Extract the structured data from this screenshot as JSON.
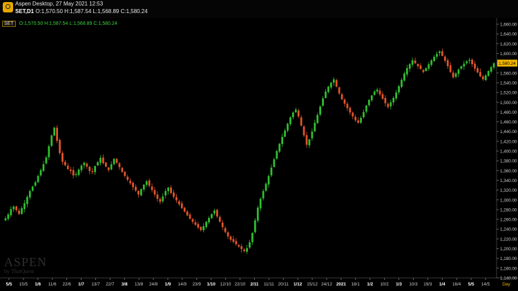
{
  "window": {
    "title": "Aspen Desktop, 27 May 2021 12:53",
    "symbol": "SET,D1",
    "ohlc": "O:1,570.50 H:1,587.54 L:1,568.89 C:1,580.24"
  },
  "legend": {
    "symbol": "SET",
    "values": "O:1,570.50 H:1,587.54 L:1,568.89 C:1,580.24"
  },
  "watermark": {
    "main": "ASPEN",
    "sub": "by ThaiQuest"
  },
  "colors": {
    "up": "#2fc02f",
    "down": "#e2552b",
    "price_badge": "#f2b600",
    "axis_text": "#cfcfcf"
  },
  "chart_data": {
    "type": "candlestick",
    "ylim": [
      1140,
      1670
    ],
    "y_ticks": [
      "1,140.00",
      "1,160.00",
      "1,180.00",
      "1,200.00",
      "1,220.00",
      "1,240.00",
      "1,260.00",
      "1,280.00",
      "1,300.00",
      "1,320.00",
      "1,340.00",
      "1,360.00",
      "1,380.00",
      "1,400.00",
      "1,420.00",
      "1,440.00",
      "1,460.00",
      "1,480.00",
      "1,500.00",
      "1,520.00",
      "1,540.00",
      "1,560.00",
      "1,580.00",
      "1,600.00",
      "1,620.00",
      "1,640.00",
      "1,660.00"
    ],
    "x_ticks": [
      "5/5",
      "15/5",
      "1/6",
      "11/6",
      "22/6",
      "1/7",
      "13/7",
      "22/7",
      "3/8",
      "13/8",
      "24/8",
      "1/9",
      "14/9",
      "23/9",
      "1/10",
      "12/10",
      "22/10",
      "2/11",
      "11/11",
      "20/11",
      "1/12",
      "15/12",
      "24/12",
      "2021",
      "18/1",
      "1/2",
      "10/2",
      "1/3",
      "10/3",
      "19/3",
      "1/4",
      "16/4",
      "5/5",
      "14/5"
    ],
    "bold_ticks": [
      "5/5",
      "1/6",
      "1/7",
      "3/8",
      "1/9",
      "1/10",
      "2/11",
      "1/12",
      "2021",
      "1/2",
      "1/3",
      "1/4",
      "5/5"
    ],
    "period_label": "Day",
    "last_price": "1,580.24",
    "last_value": 1580.24,
    "closes": [
      1262,
      1270,
      1281,
      1286,
      1279,
      1271,
      1283,
      1293,
      1306,
      1318,
      1327,
      1336,
      1349,
      1361,
      1373,
      1387,
      1410,
      1432,
      1448,
      1421,
      1396,
      1378,
      1371,
      1363,
      1359,
      1350,
      1353,
      1362,
      1370,
      1376,
      1368,
      1359,
      1357,
      1369,
      1377,
      1386,
      1375,
      1368,
      1361,
      1373,
      1384,
      1376,
      1367,
      1357,
      1349,
      1341,
      1334,
      1326,
      1319,
      1311,
      1322,
      1331,
      1338,
      1329,
      1320,
      1311,
      1302,
      1296,
      1307,
      1318,
      1325,
      1314,
      1306,
      1299,
      1291,
      1283,
      1276,
      1268,
      1261,
      1255,
      1249,
      1243,
      1238,
      1246,
      1255,
      1263,
      1271,
      1278,
      1266,
      1255,
      1244,
      1234,
      1225,
      1218,
      1214,
      1209,
      1204,
      1199,
      1195,
      1201,
      1213,
      1232,
      1258,
      1284,
      1302,
      1318,
      1333,
      1349,
      1366,
      1383,
      1400,
      1415,
      1429,
      1442,
      1456,
      1469,
      1479,
      1485,
      1471,
      1452,
      1432,
      1413,
      1424,
      1440,
      1458,
      1474,
      1491,
      1508,
      1522,
      1532,
      1540,
      1547,
      1532,
      1518,
      1506,
      1497,
      1488,
      1479,
      1471,
      1463,
      1458,
      1468,
      1480,
      1493,
      1505,
      1514,
      1522,
      1526,
      1516,
      1507,
      1498,
      1490,
      1500,
      1509,
      1520,
      1533,
      1546,
      1559,
      1570,
      1578,
      1586,
      1580,
      1574,
      1568,
      1562,
      1570,
      1578,
      1586,
      1593,
      1599,
      1604,
      1595,
      1585,
      1574,
      1562,
      1551,
      1559,
      1567,
      1574,
      1579,
      1584,
      1587,
      1578,
      1569,
      1561,
      1553,
      1547,
      1555,
      1564,
      1572,
      1580
    ]
  }
}
